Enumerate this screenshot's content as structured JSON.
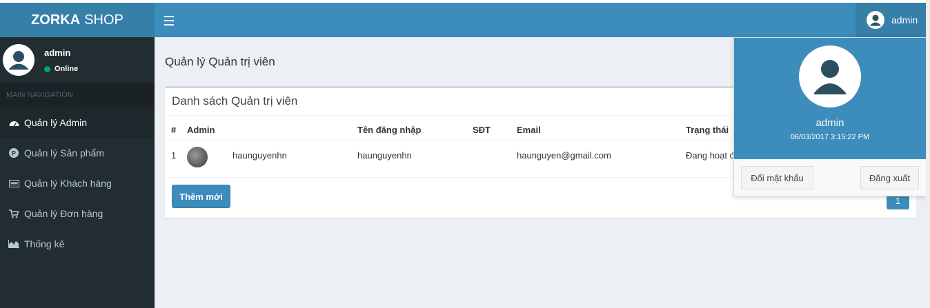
{
  "header": {
    "logo_bold": "ZORKA",
    "logo_rest": "SHOP",
    "user_name": "admin"
  },
  "sidebar": {
    "user_name": "admin",
    "status": "Online",
    "nav_header": "MAIN NAVIGATION",
    "items": [
      {
        "label": "Quản lý Admin",
        "icon": "dashboard-icon"
      },
      {
        "label": "Quản lý Sản phẩm",
        "icon": "product-p-icon"
      },
      {
        "label": "Quản lý Khách hàng",
        "icon": "list-icon"
      },
      {
        "label": "Quản lý Đơn hàng",
        "icon": "cart-icon"
      },
      {
        "label": "Thống kê",
        "icon": "area-chart-icon"
      }
    ]
  },
  "main": {
    "page_title": "Quản lý Quản trị viên",
    "box_title": "Danh sách Quản trị viên",
    "columns": [
      "#",
      "Admin",
      "Tên đăng nhập",
      "SĐT",
      "Email",
      "Trạng thái"
    ],
    "rows": [
      {
        "index": "1",
        "admin": "haunguyenhn",
        "username": "haunguyenhn",
        "phone": "",
        "email": "haunguyen@gmail.com",
        "status": "Đang hoạt đ"
      }
    ],
    "add_button": "Thêm mới",
    "page_number": "1"
  },
  "dropdown": {
    "name": "admin",
    "time": "06/03/2017 3:15:22 PM",
    "change_password": "Đổi mật khẩu",
    "logout": "Đăng xuất"
  },
  "colors": {
    "navbar": "#3c8dbc",
    "logo_bg": "#367fa9",
    "sidebar": "#222d32",
    "online": "#00a65a"
  }
}
